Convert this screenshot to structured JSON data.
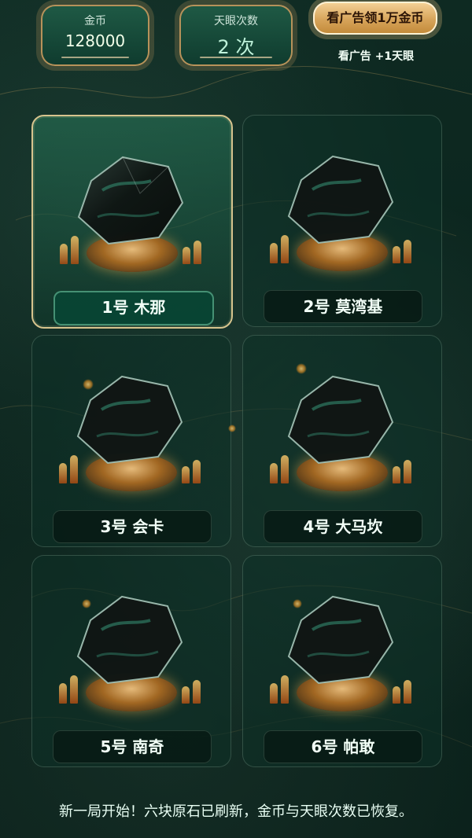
{
  "hud": {
    "coins_title": "金币",
    "coins_value": "128000",
    "eye_title": "天眼次数",
    "eye_value": "2 次"
  },
  "actions": {
    "ad_coins_label": "看广告领1万金币",
    "ad_eye_label": "看广告 +1天眼"
  },
  "stones": [
    {
      "label": "1号 木那",
      "selected": true
    },
    {
      "label": "2号 莫湾基",
      "selected": false
    },
    {
      "label": "3号 会卡",
      "selected": false
    },
    {
      "label": "4号 大马坎",
      "selected": false
    },
    {
      "label": "5号 南奇",
      "selected": false
    },
    {
      "label": "6号 帕敢",
      "selected": false
    }
  ],
  "status_message": "新一局开始！六块原石已刷新，金币与天眼次数已恢复。",
  "colors": {
    "panel_border": "#b7925a",
    "gold_button": "#d7a45a",
    "selected_border": "#d7c48e",
    "rock_dark": "#0f1614",
    "rock_jade": "#2f7a62"
  }
}
